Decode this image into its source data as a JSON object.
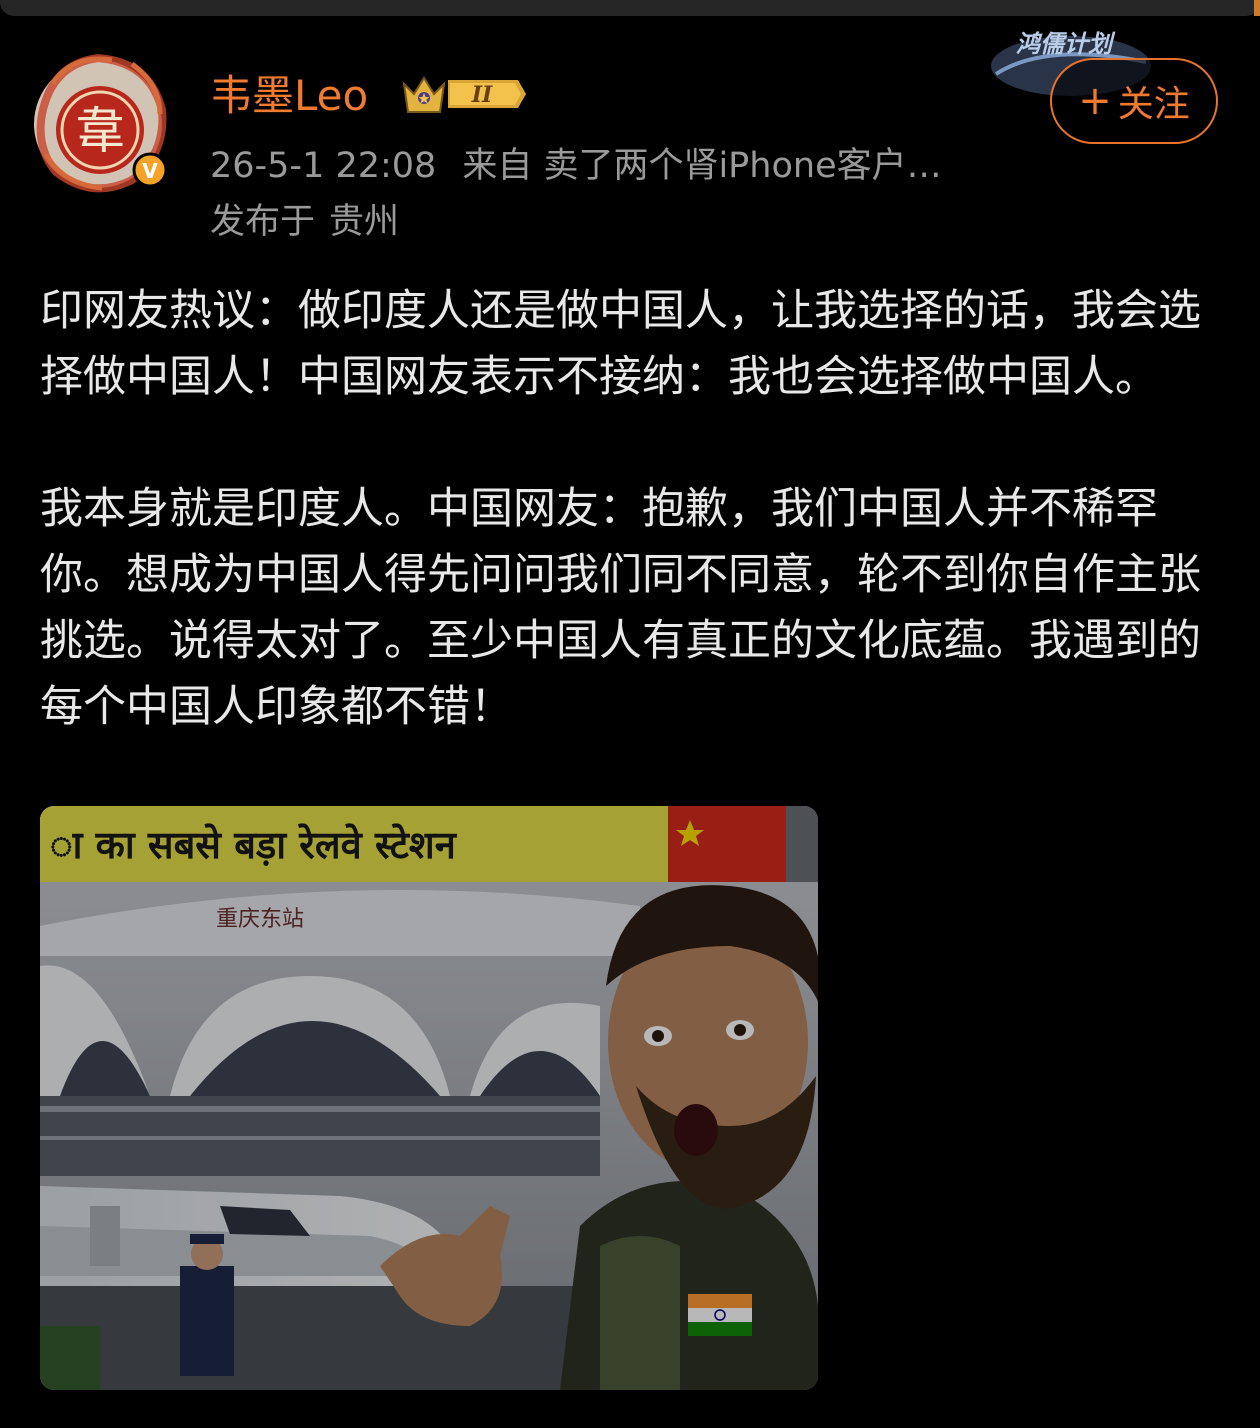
{
  "header": {
    "author_name": "韦墨Leo",
    "vip_level": "II",
    "timestamp": "26-5-1 22:08",
    "source": "来自 卖了两个肾iPhone客户…",
    "location_prefix": "发布于",
    "location": "贵州",
    "follow_label": "关注",
    "follow_plus": "+",
    "avatar_char": "韋",
    "verified_mark": "V",
    "deco_text": "鸿儒计划"
  },
  "post": {
    "paragraph1": "印网友热议：做印度人还是做中国人，让我选择的话，我会选择做中国人！中国网友表示不接纳：我也会选择做中国人。",
    "paragraph2": "我本身就是印度人。中国网友：抱歉，我们中国人并不稀罕你。想成为中国人得先问问我们同不同意，轮不到你自作主张挑选。说得太对了。至少中国人有真正的文化底蕴。我遇到的每个中国人印象都不错！"
  },
  "image": {
    "banner_text": "ा का सबसे बड़ा रेलवे स्टेशन",
    "station_sign": "重庆东站"
  },
  "colors": {
    "accent": "#f07a2e",
    "meta": "#9a9a9a",
    "background": "#000000",
    "text": "#e8e8e8"
  }
}
